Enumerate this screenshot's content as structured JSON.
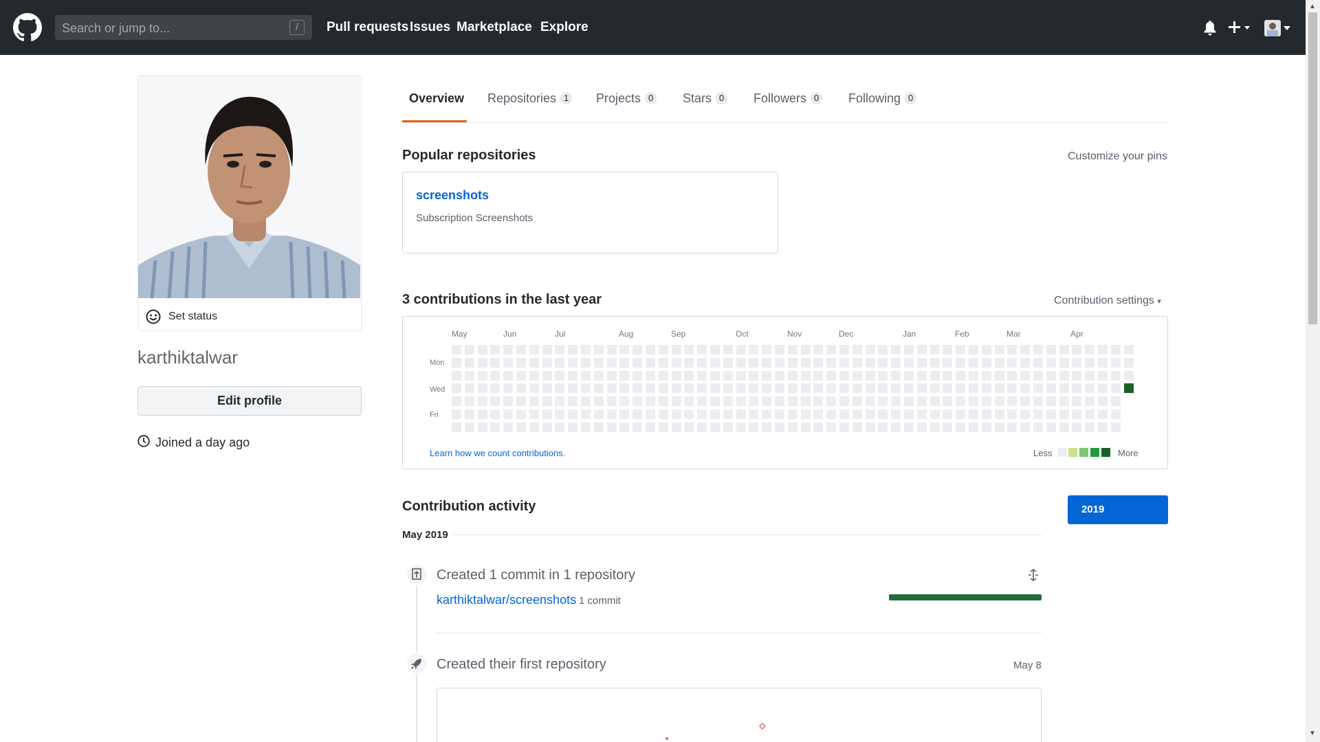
{
  "header": {
    "search_placeholder": "Search or jump to...",
    "search_shortcut": "/",
    "nav": [
      "Pull requests",
      "Issues",
      "Marketplace",
      "Explore"
    ],
    "icons": [
      "github-logo",
      "bell-icon",
      "plus-icon",
      "avatar-icon"
    ]
  },
  "profile": {
    "set_status": "Set status",
    "username": "karthiktalwar",
    "edit_profile": "Edit profile",
    "joined": "Joined a day ago"
  },
  "tabs": [
    {
      "label": "Overview",
      "count": null
    },
    {
      "label": "Repositories",
      "count": "1"
    },
    {
      "label": "Projects",
      "count": "0"
    },
    {
      "label": "Stars",
      "count": "0"
    },
    {
      "label": "Followers",
      "count": "0"
    },
    {
      "label": "Following",
      "count": "0"
    }
  ],
  "popular": {
    "heading": "Popular repositories",
    "customize": "Customize your pins",
    "repo_name": "screenshots",
    "repo_desc": "Subscription Screenshots"
  },
  "contributions": {
    "heading": "3 contributions in the last year",
    "settings": "Contribution settings",
    "months": [
      "May",
      "Jun",
      "Jul",
      "Aug",
      "Sep",
      "Oct",
      "Nov",
      "Dec",
      "Jan",
      "Feb",
      "Mar",
      "Apr"
    ],
    "day_labels": [
      "Mon",
      "Wed",
      "Fri"
    ],
    "learn_link": "Learn how we count contributions.",
    "legend_less": "Less",
    "legend_more": "More",
    "legend_colors": [
      "#ebedf0",
      "#c6e48b",
      "#7bc96f",
      "#239a3b",
      "#196127"
    ],
    "highlight_color": "#196127"
  },
  "activity": {
    "heading": "Contribution activity",
    "year": "2019",
    "month": "May 2019",
    "item1_title": "Created 1 commit in 1 repository",
    "item1_repo": "karthiktalwar/screenshots",
    "item1_commits": "1 commit",
    "item2_title": "Created their first repository",
    "item2_date": "May 8"
  }
}
